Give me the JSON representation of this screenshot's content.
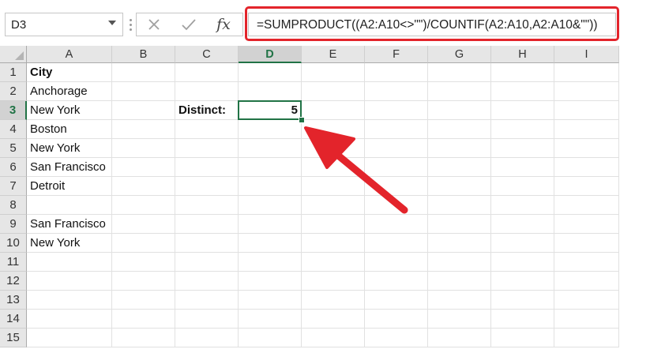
{
  "formula_bar": {
    "name_box": "D3",
    "cancel_glyph": "✕",
    "enter_glyph": "✓",
    "fx_label": "fx",
    "formula": "=SUMPRODUCT((A2:A10<>\"\")/COUNTIF(A2:A10,A2:A10&\"\"))"
  },
  "columns": [
    "A",
    "B",
    "C",
    "D",
    "E",
    "F",
    "G",
    "H",
    "I"
  ],
  "rows": [
    "1",
    "2",
    "3",
    "4",
    "5",
    "6",
    "7",
    "8",
    "9",
    "10",
    "11",
    "12",
    "13",
    "14",
    "15"
  ],
  "selected": {
    "cell": "D3",
    "column": "D",
    "row": "3"
  },
  "column_a": [
    "City",
    "Anchorage",
    "New York",
    "Boston",
    "New York",
    "San Francisco",
    "Detroit",
    "",
    "San Francisco",
    "New York"
  ],
  "label_c3": "Distinct:",
  "value_d3": "5",
  "annotation_colors": {
    "highlight": "#e3242b",
    "arrow": "#e3242b",
    "selection": "#217346"
  }
}
